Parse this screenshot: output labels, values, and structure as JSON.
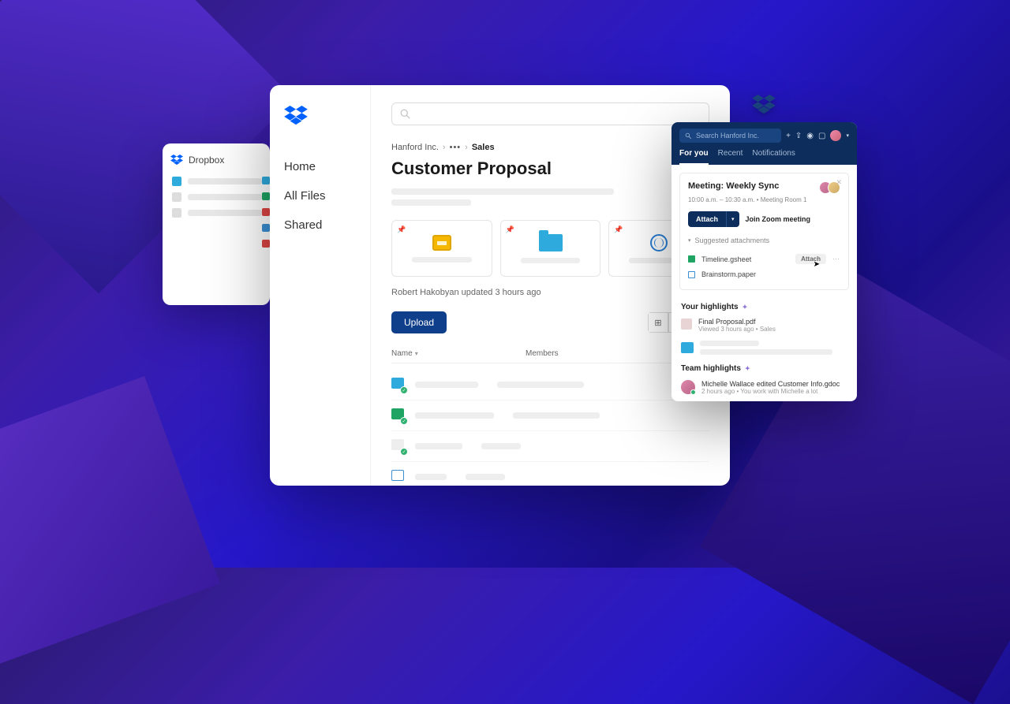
{
  "back_window": {
    "title": "Dropbox"
  },
  "sidebar": {
    "nav": {
      "home": "Home",
      "all_files": "All Files",
      "shared": "Shared"
    }
  },
  "breadcrumb": {
    "root": "Hanford Inc.",
    "current": "Sales"
  },
  "page_title": "Customer Proposal",
  "author_line": "Robert Hakobyan updated 3 hours ago",
  "toolbar": {
    "upload": "Upload"
  },
  "table": {
    "col_name": "Name",
    "col_members": "Members"
  },
  "ext": {
    "search_placeholder": "Search Hanford Inc.",
    "tabs": {
      "for_you": "For you",
      "recent": "Recent",
      "notifications": "Notifications"
    },
    "meeting": {
      "title": "Meeting: Weekly Sync",
      "meta": "10:00 a.m. – 10:30 a.m. • Meeting Room 1",
      "attach": "Attach",
      "zoom": "Join Zoom meeting",
      "suggested_label": "Suggested attachments",
      "suggestions": [
        {
          "name": "Timeline.gsheet",
          "color": "#1fa463",
          "attach": "Attach"
        },
        {
          "name": "Brainstorm.paper",
          "color": "#3a8fd4"
        }
      ]
    },
    "your_highlights": {
      "label": "Your highlights",
      "item_title": "Final Proposal.pdf",
      "item_meta": "Viewed 3 hours ago • Sales"
    },
    "team_highlights": {
      "label": "Team highlights",
      "item_title": "Michelle Wallace edited Customer Info.gdoc",
      "item_meta": "2 hours ago • You work with Michelle a lot"
    }
  },
  "colors": {
    "primary": "#0d2e5c",
    "dropbox_blue": "#0061ff"
  }
}
